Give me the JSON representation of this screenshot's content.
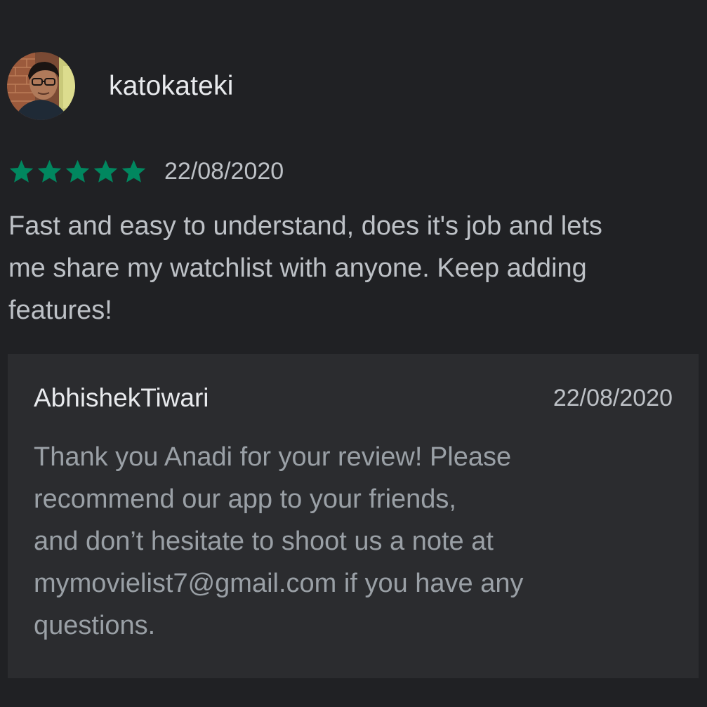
{
  "review": {
    "author": "katokateki",
    "avatar_icon": "user-avatar-photo",
    "rating": 5,
    "rating_max": 5,
    "date": "22/08/2020",
    "text_lines": [
      "Fast and easy to understand, does it's job and lets",
      "me share my watchlist with anyone. Keep adding",
      "features!"
    ]
  },
  "reply": {
    "author": "AbhishekTiwari",
    "date": "22/08/2020",
    "text_lines": [
      "Thank you Anadi for your review! Please",
      "recommend our app to your friends,",
      "and don’t hesitate to shoot us a note at",
      "mymovielist7@gmail.com if you have any",
      "questions."
    ]
  },
  "colors": {
    "background": "#202124",
    "reply_background": "#2b2c2f",
    "star": "#01875f",
    "primary_text": "#e8eaed",
    "secondary_text": "#bdc1c6",
    "reply_text": "#9aa0a6"
  }
}
